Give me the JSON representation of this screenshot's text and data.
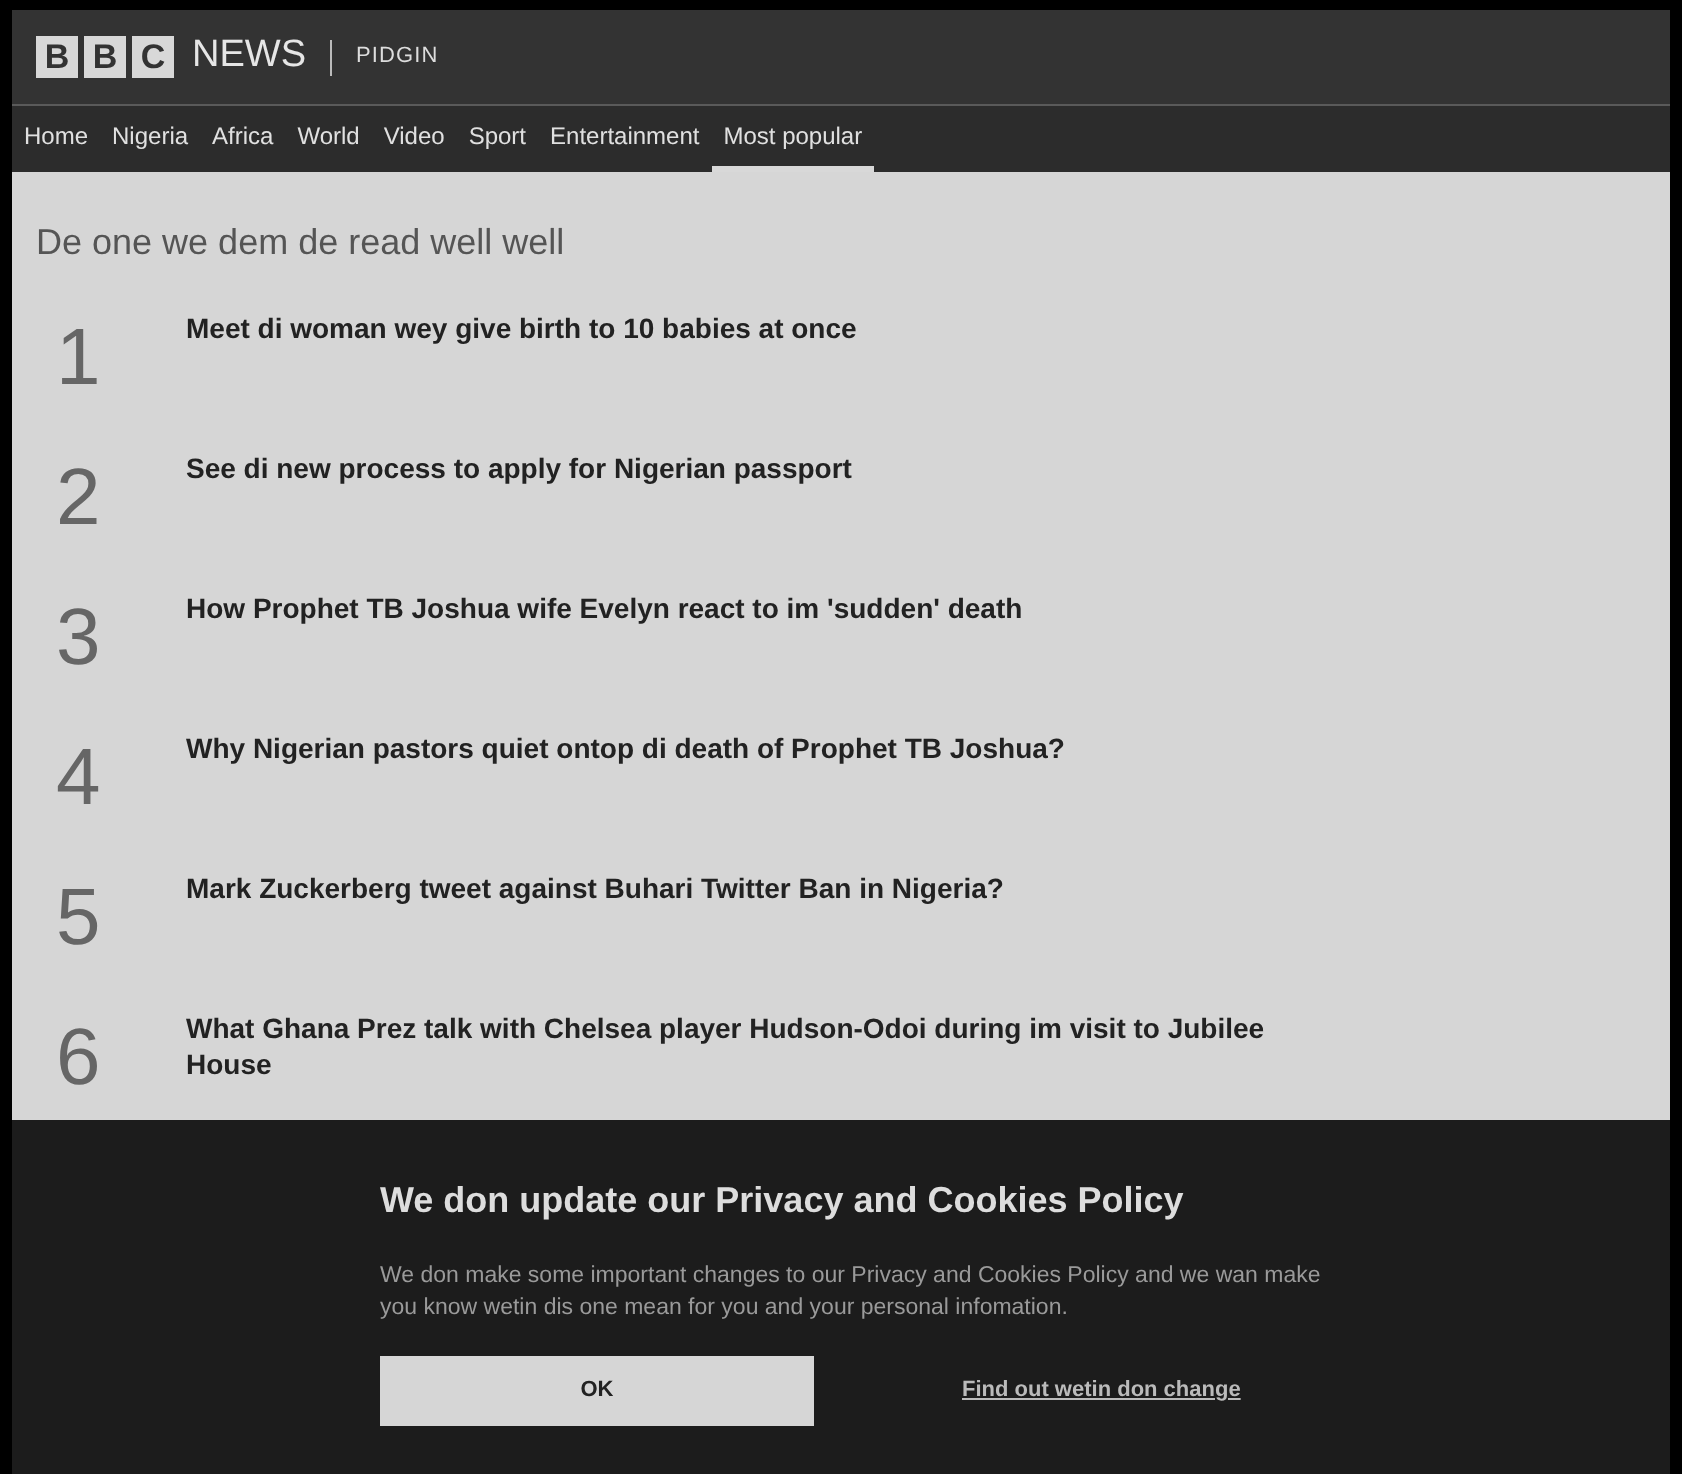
{
  "header": {
    "logo_letters": [
      "B",
      "B",
      "C"
    ],
    "brand": "NEWS",
    "edition": "PIDGIN"
  },
  "nav": [
    {
      "label": "Home",
      "selected": false
    },
    {
      "label": "Nigeria",
      "selected": false
    },
    {
      "label": "Africa",
      "selected": false
    },
    {
      "label": "World",
      "selected": false
    },
    {
      "label": "Video",
      "selected": false
    },
    {
      "label": "Sport",
      "selected": false
    },
    {
      "label": "Entertainment",
      "selected": false
    },
    {
      "label": "Most popular",
      "selected": true
    }
  ],
  "section_title": "De one we dem de read well well",
  "articles": [
    {
      "rank": "1",
      "title": "Meet di woman wey give birth to 10 babies at once"
    },
    {
      "rank": "2",
      "title": "See di new process to apply for Nigerian passport"
    },
    {
      "rank": "3",
      "title": "How Prophet TB Joshua wife Evelyn react to im 'sudden' death"
    },
    {
      "rank": "4",
      "title": "Why Nigerian pastors quiet ontop di death of Prophet TB Joshua?"
    },
    {
      "rank": "5",
      "title": "Mark Zuckerberg tweet against Buhari Twitter Ban in Nigeria?"
    },
    {
      "rank": "6",
      "title": "What Ghana Prez talk with Chelsea player Hudson-Odoi during im visit to Jubilee House"
    }
  ],
  "cookie_banner": {
    "title": "We don update our Privacy and Cookies Policy",
    "body": "We don make some important changes to our Privacy and Cookies Policy and we wan make you know wetin dis one mean for you and your personal infomation.",
    "ok_button": "OK",
    "link": "Find out wetin don change"
  }
}
